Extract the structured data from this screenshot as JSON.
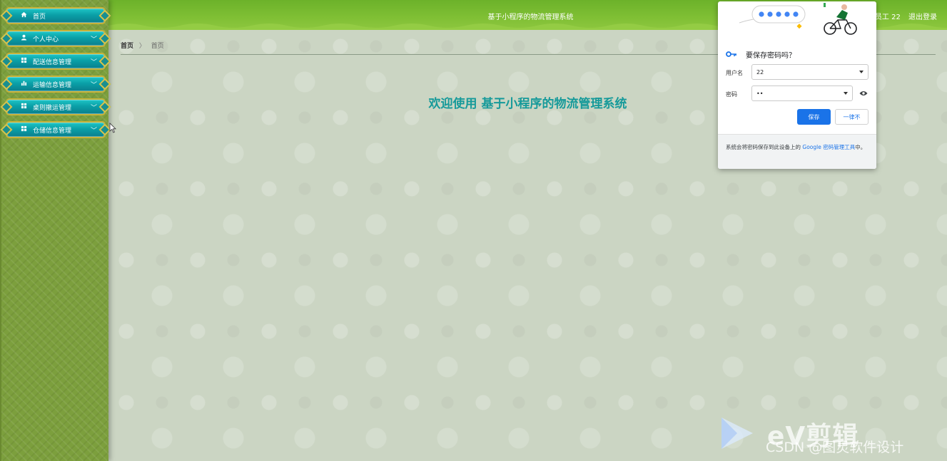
{
  "sidebar": {
    "items": [
      {
        "label": "首页",
        "icon": "home-icon",
        "has_chevron": false
      },
      {
        "label": "个人中心",
        "icon": "user-icon",
        "has_chevron": true
      },
      {
        "label": "配送信息管理",
        "icon": "grid-icon",
        "has_chevron": true
      },
      {
        "label": "运输信息管理",
        "icon": "bar-chart-icon",
        "has_chevron": true
      },
      {
        "label": "桌则撤运管理",
        "icon": "grid-icon",
        "has_chevron": true
      },
      {
        "label": "仓储信息管理",
        "icon": "grid-icon",
        "has_chevron": true
      }
    ]
  },
  "header": {
    "title": "基于小程序的物流管理系统",
    "user_label": "员工 22",
    "logout_label": "退出登录"
  },
  "breadcrumb": {
    "home": "首页",
    "separator": "〉",
    "current": "首页"
  },
  "main": {
    "welcome": "欢迎使用 基于小程序的物流管理系统"
  },
  "password_popup": {
    "question": "要保存密码吗？",
    "username_label": "用户名",
    "username_value": "22",
    "password_label": "密码",
    "password_value": "••",
    "save_label": "保存",
    "never_label": "一律不",
    "footer_text": "系统会将密码保存到此设备上的",
    "footer_link": "Google 密码管理工具",
    "footer_tail": "中。"
  },
  "watermark": {
    "brand": "eV剪辑",
    "credit": "CSDN @图灵软件设计"
  },
  "colors": {
    "menu_teal": "#0a9fa7",
    "menu_border": "#c8b23a",
    "topbar_green": "#7fbf34",
    "welcome_teal": "#169a9a",
    "google_blue": "#1a73e8"
  }
}
